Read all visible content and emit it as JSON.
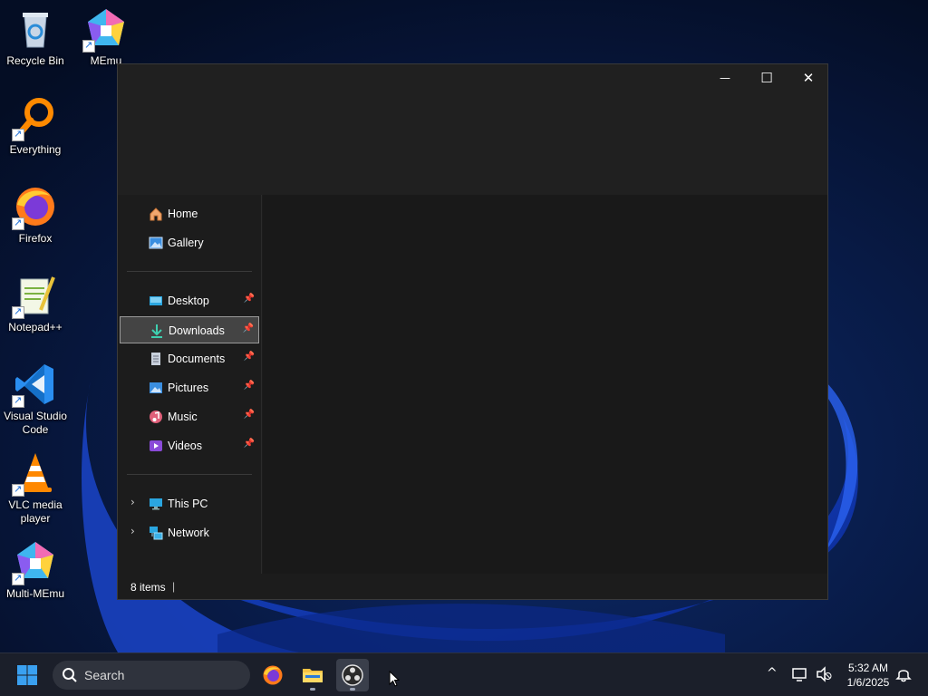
{
  "desktop": {
    "icons": [
      {
        "label": "Recycle Bin",
        "icon": "recycle-bin-icon"
      },
      {
        "label": "MEmu",
        "icon": "memu-icon"
      },
      {
        "label": "Everything",
        "icon": "everything-search-icon"
      },
      {
        "label": "Firefox",
        "icon": "firefox-icon"
      },
      {
        "label": "Notepad++",
        "icon": "notepad-plus-plus-icon"
      },
      {
        "label": "Visual Studio Code",
        "icon": "vscode-icon"
      },
      {
        "label": "VLC media player",
        "icon": "vlc-icon"
      },
      {
        "label": "Multi-MEmu",
        "icon": "multi-memu-icon"
      }
    ]
  },
  "explorer": {
    "controls": {
      "minimize": "—",
      "maximize": "☐",
      "close": "✕"
    },
    "nav": {
      "home": "Home",
      "gallery": "Gallery",
      "desktop": "Desktop",
      "downloads": "Downloads",
      "documents": "Documents",
      "pictures": "Pictures",
      "music": "Music",
      "videos": "Videos",
      "this_pc": "This PC",
      "network": "Network",
      "pin_glyph": "📌",
      "expand_glyph": "›"
    },
    "status": {
      "items": "8 items",
      "cursor": "|"
    }
  },
  "taskbar": {
    "search_label": "Search",
    "clock": {
      "time": "5:32 AM",
      "date": "1/6/2025"
    },
    "tray_chevron": "^",
    "apps": [
      "firefox-icon",
      "file-explorer-icon",
      "obs-icon"
    ],
    "accent": "#0078d4"
  }
}
